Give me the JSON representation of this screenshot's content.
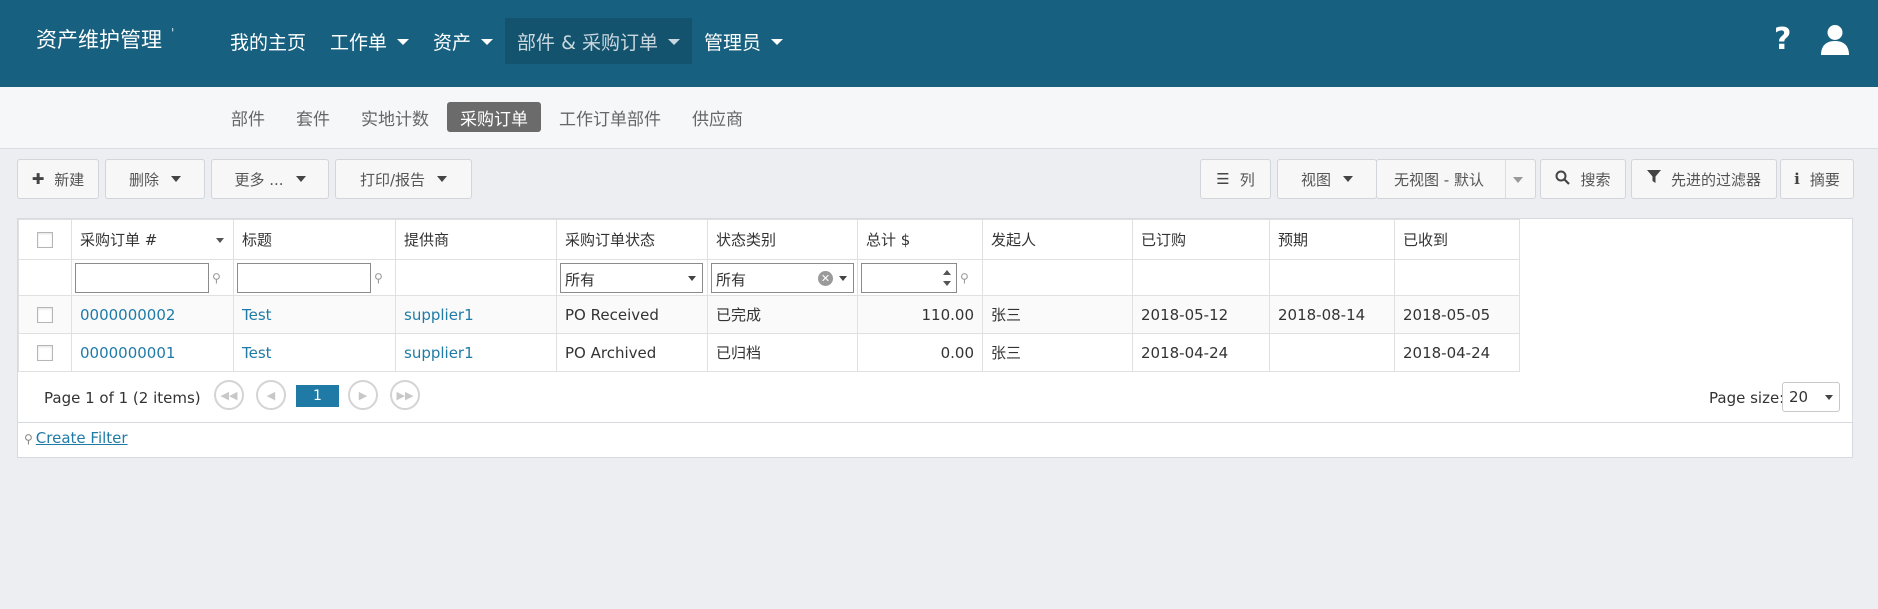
{
  "app": {
    "title": "资产维护管理",
    "title_suffix": "'"
  },
  "nav": {
    "items": [
      {
        "label": "我的主页",
        "has_caret": false
      },
      {
        "label": "工作单",
        "has_caret": true
      },
      {
        "label": "资产",
        "has_caret": true
      },
      {
        "label": "部件 & 采购订单",
        "has_caret": true,
        "active": true
      },
      {
        "label": "管理员",
        "has_caret": true
      }
    ],
    "help_icon": "?",
    "colors": {
      "bar": "#17607f",
      "active": "#14536e"
    }
  },
  "subnav": {
    "tabs": [
      "部件",
      "套件",
      "实地计数",
      "采购订单",
      "工作订单部件",
      "供应商"
    ],
    "active": "采购订单"
  },
  "toolbar": {
    "new_label": "新建",
    "delete_label": "删除",
    "more_label": "更多 ...",
    "print_label": "打印/报告",
    "columns_label": "列",
    "view_label": "视图",
    "view_select_value": "无视图 - 默认",
    "search_label": "搜索",
    "advanced_filter_label": "先进的过滤器",
    "summary_label": "摘要"
  },
  "grid": {
    "columns": [
      "采购订单 #",
      "标题",
      "提供商",
      "采购订单状态",
      "状态类别",
      "总计 $",
      "发起人",
      "已订购",
      "预期",
      "已收到"
    ],
    "filters": {
      "status_value": "所有",
      "category_value": "所有"
    },
    "rows": [
      {
        "po": "0000000002",
        "title": "Test",
        "supplier": "supplier1",
        "status": "PO Received",
        "category": "已完成",
        "total": "110.00",
        "originator": "张三",
        "ordered": "2018-05-12",
        "expected": "2018-08-14",
        "received": "2018-05-05"
      },
      {
        "po": "0000000001",
        "title": "Test",
        "supplier": "supplier1",
        "status": "PO Archived",
        "category": "已归档",
        "total": "0.00",
        "originator": "张三",
        "ordered": "2018-04-24",
        "expected": "",
        "received": "2018-04-24"
      }
    ]
  },
  "pager": {
    "info": "Page 1 of 1 (2 items)",
    "current_page": "1",
    "page_size_label": "Page size:",
    "page_size": "20"
  },
  "create_filter_label": "Create Filter"
}
